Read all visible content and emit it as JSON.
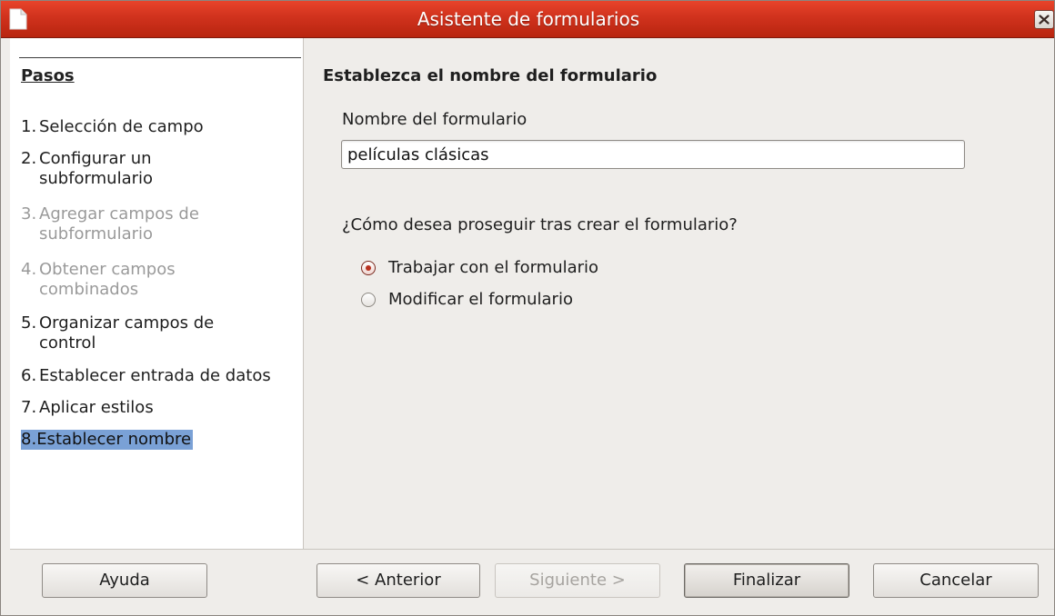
{
  "window": {
    "title": "Asistente de formularios"
  },
  "steps": {
    "heading": "Pasos",
    "items": [
      {
        "num": "1.",
        "label": "Selección de campo",
        "state": "enabled"
      },
      {
        "num": "2.",
        "label": "Configurar un subformulario",
        "state": "enabled"
      },
      {
        "num": "3.",
        "label": "Agregar campos de subformulario",
        "state": "disabled"
      },
      {
        "num": "4.",
        "label": "Obtener campos combinados",
        "state": "disabled"
      },
      {
        "num": "5.",
        "label": "Organizar campos de control",
        "state": "enabled"
      },
      {
        "num": "6.",
        "label": "Establecer entrada de datos",
        "state": "enabled"
      },
      {
        "num": "7.",
        "label": "Aplicar estilos",
        "state": "enabled"
      },
      {
        "num": "8.",
        "label": "Establecer nombre",
        "state": "selected"
      }
    ]
  },
  "main": {
    "heading": "Establezca el nombre del formulario",
    "name_label": "Nombre del formulario",
    "name_value": "películas clásicas",
    "question": "¿Cómo desea proseguir tras crear el formulario?",
    "options": [
      {
        "label": "Trabajar con el formulario",
        "checked": true
      },
      {
        "label": "Modificar el formulario",
        "checked": false
      }
    ]
  },
  "buttons": {
    "help": "Ayuda",
    "back": "< Anterior",
    "next": "Siguiente >",
    "finish": "Finalizar",
    "cancel": "Cancelar"
  },
  "colors": {
    "titlebar": "#d0321d",
    "selection": "#7aa1d6",
    "radio_dot": "#b8301e"
  }
}
